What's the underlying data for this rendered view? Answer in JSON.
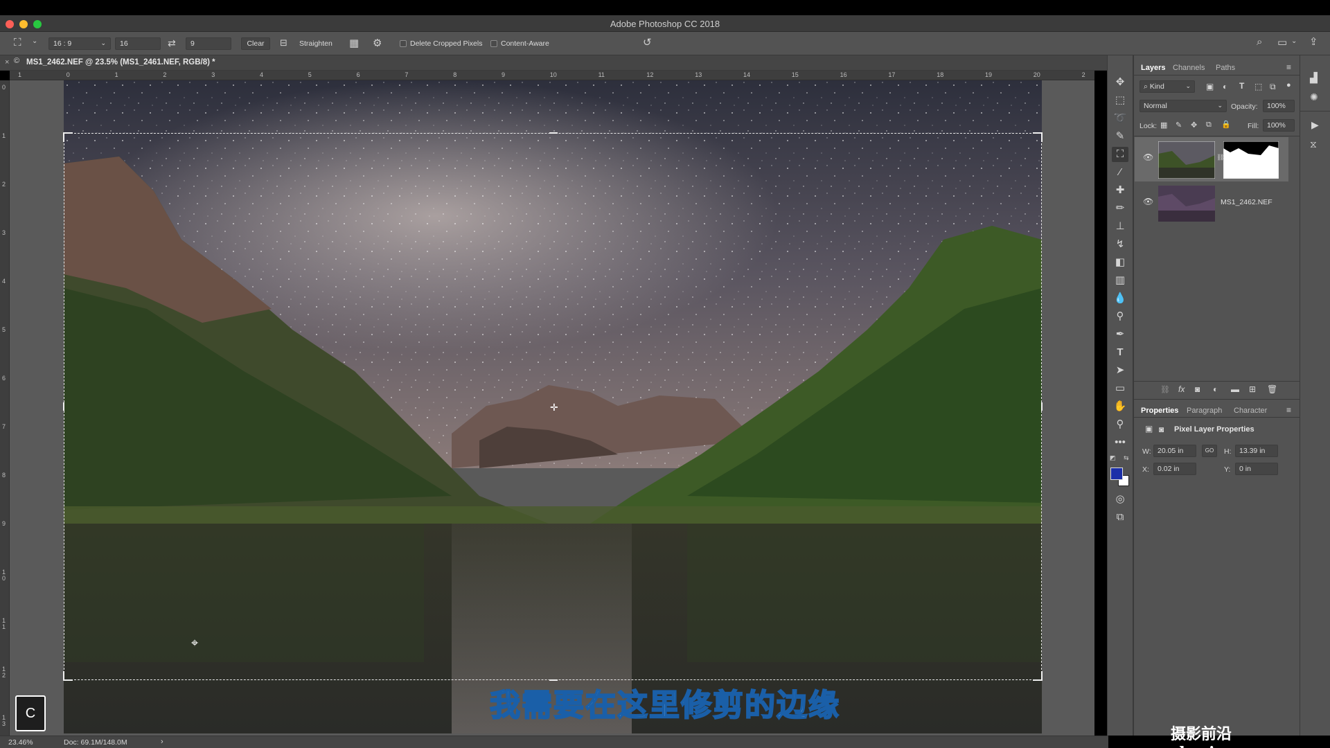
{
  "window": {
    "title": "Adobe Photoshop CC 2018"
  },
  "options_bar": {
    "ratio": "16 : 9",
    "width_value": "16",
    "height_value": "9",
    "clear_label": "Clear",
    "straighten_label": "Straighten",
    "delete_cropped_label": "Delete Cropped Pixels",
    "content_aware_label": "Content-Aware"
  },
  "document": {
    "tab_title": "MS1_2462.NEF @ 23.5% (MS1_2461.NEF, RGB/8) *",
    "zoom": "23.46%",
    "doc_info": "Doc: 69.1M/148.0M"
  },
  "rulers": {
    "horizontal": [
      "1",
      "0",
      "1",
      "2",
      "3",
      "4",
      "5",
      "6",
      "7",
      "8",
      "9",
      "10",
      "11",
      "12",
      "13",
      "14",
      "15",
      "16",
      "17",
      "18",
      "19",
      "20",
      "2"
    ],
    "vertical": [
      "0",
      "1",
      "2",
      "3",
      "4",
      "5",
      "6",
      "7",
      "8",
      "9",
      "1 0",
      "1 1",
      "1 2",
      "1 3"
    ]
  },
  "overlay": {
    "subtitle": "我需要在这里修剪的边缘",
    "key_pressed": "C",
    "watermark": "摄影前沿 sheyingzyz.com"
  },
  "layers_panel": {
    "tabs": [
      "Layers",
      "Channels",
      "Paths"
    ],
    "filter_kind": "Kind",
    "blend_mode": "Normal",
    "opacity_label": "Opacity:",
    "opacity_value": "100%",
    "lock_label": "Lock:",
    "fill_label": "Fill:",
    "fill_value": "100%",
    "layers": [
      {
        "name": "",
        "has_mask": true
      },
      {
        "name": "MS1_2462.NEF",
        "has_mask": false
      }
    ]
  },
  "properties_panel": {
    "tabs": [
      "Properties",
      "Paragraph",
      "Character"
    ],
    "heading": "Pixel Layer Properties",
    "w_label": "W:",
    "w_value": "20.05 in",
    "h_label": "H:",
    "h_value": "13.39 in",
    "x_label": "X:",
    "x_value": "0.02 in",
    "y_label": "Y:",
    "y_value": "0 in",
    "link_label": "GO"
  },
  "colors": {
    "foreground": "#1b2fa8",
    "background": "#ffffff",
    "ui_dark": "#535353",
    "subtitle_fill": "#b9e6ff"
  }
}
